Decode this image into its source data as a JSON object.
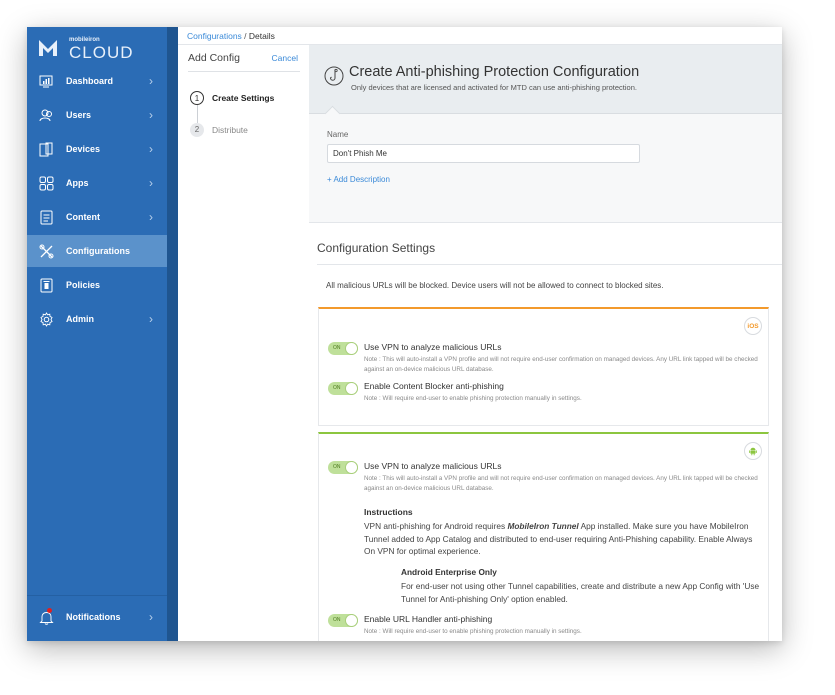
{
  "brand": {
    "small": "mobileiron",
    "big": "CLOUD"
  },
  "sidebar": {
    "items": [
      {
        "label": "Dashboard",
        "icon": "dashboard-icon",
        "chevron": true,
        "active": false
      },
      {
        "label": "Users",
        "icon": "users-icon",
        "chevron": true,
        "active": false
      },
      {
        "label": "Devices",
        "icon": "devices-icon",
        "chevron": true,
        "active": false
      },
      {
        "label": "Apps",
        "icon": "apps-icon",
        "chevron": true,
        "active": false
      },
      {
        "label": "Content",
        "icon": "content-icon",
        "chevron": true,
        "active": false
      },
      {
        "label": "Configurations",
        "icon": "configurations-icon",
        "chevron": false,
        "active": true
      },
      {
        "label": "Policies",
        "icon": "policies-icon",
        "chevron": false,
        "active": false
      },
      {
        "label": "Admin",
        "icon": "gear-icon",
        "chevron": true,
        "active": false
      }
    ],
    "notifications": {
      "label": "Notifications",
      "icon": "bell-icon",
      "has_alert": true
    }
  },
  "breadcrumb": {
    "link": "Configurations",
    "separator": " / ",
    "current": "Details"
  },
  "stepper": {
    "title": "Add Config",
    "cancel": "Cancel",
    "steps": [
      {
        "number": "1",
        "label": "Create Settings",
        "state": "current"
      },
      {
        "number": "2",
        "label": "Distribute",
        "state": "pending"
      }
    ]
  },
  "header": {
    "icon": "hook-icon",
    "title": "Create Anti-phishing Protection Configuration",
    "subtitle": "Only devices that are licensed and activated for MTD can use anti-phishing protection."
  },
  "name_section": {
    "label": "Name",
    "value": "Don't Phish Me",
    "add_description": "+ Add Description"
  },
  "config_settings": {
    "title": "Configuration Settings",
    "description": "All malicious URLs will be blocked. Device users will not be allowed to connect to blocked sites.",
    "ios": {
      "badge": "iOS",
      "accent": "#f39a2c",
      "options": [
        {
          "toggle": "ON",
          "label": "Use VPN to analyze malicious URLs",
          "note": "Note : This will auto-install a VPN profile and will not require end-user confirmation on managed devices. Any URL link tapped will be checked against an on-device malicious URL database."
        },
        {
          "toggle": "ON",
          "label": "Enable Content Blocker anti-phishing",
          "note": "Note : Will require end-user to enable phishing protection manually in settings."
        }
      ]
    },
    "android": {
      "badge": "android-icon",
      "accent": "#8cc63f",
      "options": [
        {
          "toggle": "ON",
          "label": "Use VPN to analyze malicious URLs",
          "note": "Note : This will auto-install a VPN profile and will not require end-user confirmation on managed devices. Any URL link tapped will be checked against an on-device malicious URL database."
        },
        {
          "toggle": "ON",
          "label": "Enable URL Handler anti-phishing",
          "note": "Note : Will require end-user to enable phishing protection manually in settings."
        }
      ],
      "instructions": {
        "title": "Instructions",
        "text_before": "VPN anti-phishing for Android requires ",
        "text_emphasis": "MobileIron Tunnel",
        "text_after": " App installed. Make sure you have MobileIron Tunnel added to App Catalog and distributed to end-user requiring Anti-Phishing capability. Enable Always On VPN for optimal experience."
      },
      "enterprise": {
        "title": "Android Enterprise Only",
        "text": "For end-user not using other Tunnel capabilities, create and distribute a new App Config with 'Use Tunnel for Anti-phishing Only' option enabled."
      }
    }
  }
}
